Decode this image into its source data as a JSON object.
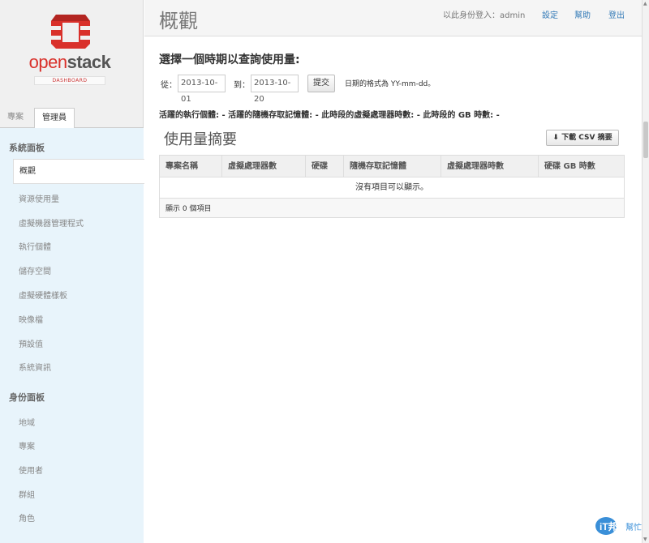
{
  "sidebar": {
    "brand_open": "open",
    "brand_stack": "stack",
    "brand_sub": "DASHBOARD",
    "tabs": [
      {
        "label": "專案"
      },
      {
        "label": "管理員"
      }
    ],
    "system_panel_heading": "系統面板",
    "system_items": [
      {
        "label": "概觀"
      },
      {
        "label": "資源使用量"
      },
      {
        "label": "虛擬機器管理程式"
      },
      {
        "label": "執行個體"
      },
      {
        "label": "儲存空間"
      },
      {
        "label": "虛擬硬體樣板"
      },
      {
        "label": "映像檔"
      },
      {
        "label": "預設值"
      },
      {
        "label": "系統資訊"
      }
    ],
    "identity_panel_heading": "身份面板",
    "identity_items": [
      {
        "label": "地域"
      },
      {
        "label": "專案"
      },
      {
        "label": "使用者"
      },
      {
        "label": "群組"
      },
      {
        "label": "角色"
      }
    ]
  },
  "topbar": {
    "title": "概觀",
    "logged_in_as": "以此身份登入：admin",
    "settings": "設定",
    "help": "幫助",
    "logout": "登出"
  },
  "query": {
    "heading": "選擇一個時期以查詢使用量:",
    "from_label": "從：",
    "from_value": "2013-10-01",
    "to_label": "到：",
    "to_value": "2013-10-20",
    "submit": "提交",
    "date_hint": "日期的格式為 YY-mm-dd。"
  },
  "stats_line": "活躍的執行個體: - 活躍的隨機存取記憶體: - 此時段的虛擬處理器時數: - 此時段的 GB 時數: -",
  "summary": {
    "title": "使用量摘要",
    "download_button": "下載 CSV 摘要",
    "columns": [
      "專案名稱",
      "虛擬處理器數",
      "硬碟",
      "隨機存取記憶體",
      "虛擬處理器時數",
      "硬碟 GB 時數"
    ],
    "empty_message": "沒有項目可以顯示。",
    "footer": "顯示 0 個項目"
  },
  "watermark": {
    "main": "iT邦",
    "sub": "幫忙"
  },
  "colors": {
    "brand_red": "#d9302a",
    "link": "#337ab7",
    "nav_bg": "#e8f4fb"
  }
}
